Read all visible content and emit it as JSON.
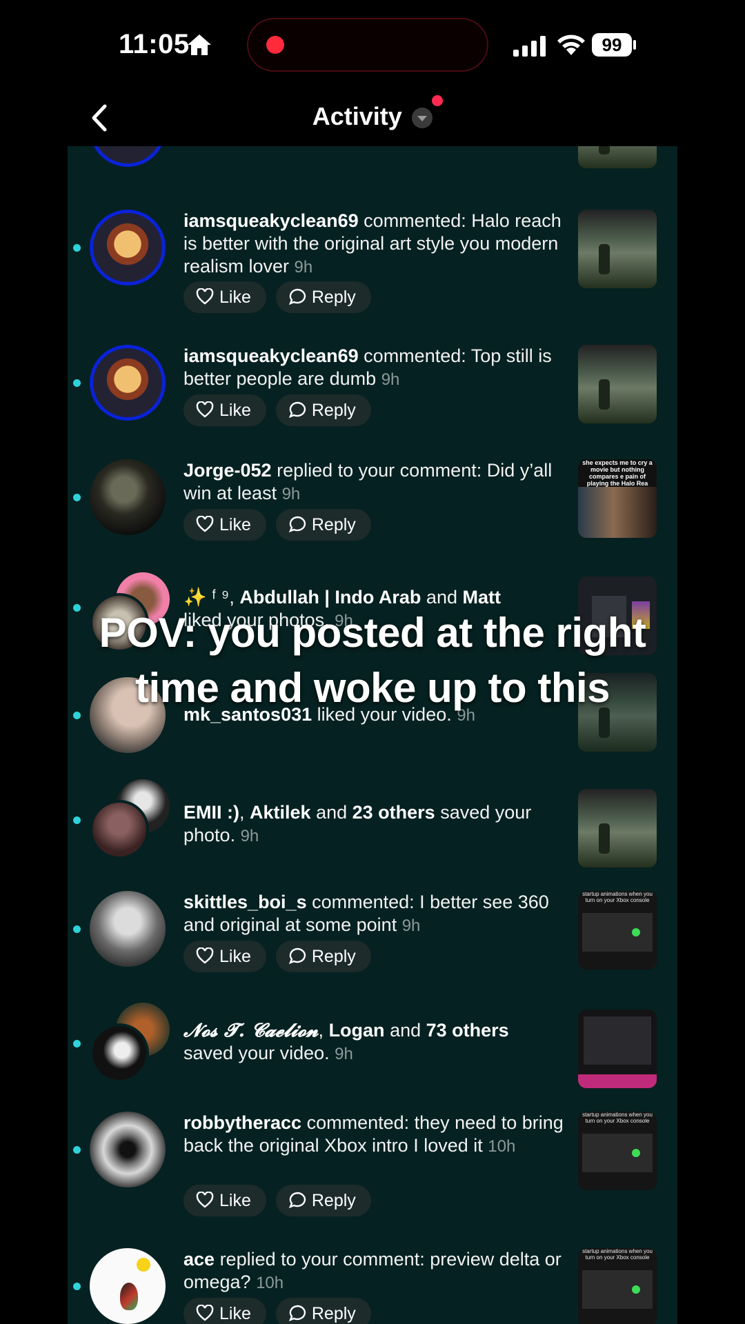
{
  "status_bar": {
    "time": "11:05",
    "battery": "99"
  },
  "header": {
    "title": "Activity"
  },
  "actions": {
    "like": "Like",
    "reply": "Reply"
  },
  "items": [
    {
      "user": "iamsqueakyclean69",
      "text": " commented: Halo reach is better with the original art style you modern realism lover ",
      "time": "9h"
    },
    {
      "user": "iamsqueakyclean69",
      "text": " commented: Top still is better people are dumb ",
      "time": "9h"
    },
    {
      "user": "Jorge-052",
      "text": " replied to your comment: Did y’all win at least ",
      "time": "9h",
      "thumb_caption": "she expects me to cry a movie but nothing compares e pain of playing the Halo Rea campaign for the first time"
    },
    {
      "prefix": "✨ ᶠ ⁹, ",
      "user": "Abdullah | Indo Arab",
      "and": " and ",
      "user2": "Matt",
      "text": "liked your photos. ",
      "time": "9h"
    },
    {
      "user": "mk_santos031",
      "text": " liked your video. ",
      "time": "9h"
    },
    {
      "user": "EMII :)",
      "sep": ", ",
      "user2": "Aktilek",
      "and": " and ",
      "others": "23 others",
      "text": " saved your photo. ",
      "time": "9h"
    },
    {
      "user": "skittles_boi_s",
      "text": " commented: I better see 360 and original at some point ",
      "time": "9h",
      "thumb_caption": "startup animations when you turn on your Xbox console"
    },
    {
      "user": "𝓝𝓸𝓼 𝓣. 𝓒𝓪𝓮𝓵𝓲𝓸𝓷",
      "sep": ", ",
      "user2": "Logan",
      "and": " and ",
      "others": "73 others",
      "text": "saved your video. ",
      "time": "9h"
    },
    {
      "user": "robbytheracc",
      "text": " commented: they need to bring back the original Xbox intro I loved it ",
      "time": "10h",
      "thumb_caption": "startup animations when you turn on your Xbox console"
    },
    {
      "user": "ace",
      "text": " replied to your comment: preview delta or omega? ",
      "time": "10h",
      "thumb_caption": "startup animations when you turn on your Xbox console"
    }
  ],
  "overlay": {
    "line1": "POV: you posted at the right",
    "line2": "time and woke up to this"
  }
}
